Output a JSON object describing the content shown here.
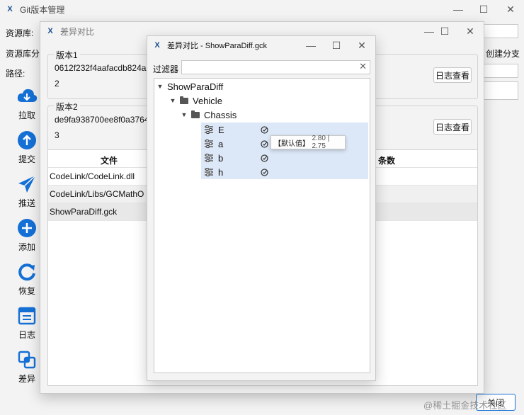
{
  "main_window": {
    "title": "Git版本管理",
    "label_repo": "资源库:",
    "label_branch": "资源库分",
    "label_path": "路径:",
    "create_branch": "创建分支",
    "close_button": "关闭",
    "toolbar": [
      {
        "label": "拉取",
        "icon": "cloud-download-icon"
      },
      {
        "label": "提交",
        "icon": "upload-icon"
      },
      {
        "label": "推送",
        "icon": "send-icon"
      },
      {
        "label": "添加",
        "icon": "add-icon"
      },
      {
        "label": "恢复",
        "icon": "restore-icon"
      },
      {
        "label": "日志",
        "icon": "log-icon"
      },
      {
        "label": "差异",
        "icon": "diff-icon"
      }
    ]
  },
  "diff_window": {
    "title": "差异对比",
    "version1": {
      "label": "版本1",
      "hash": "0612f232f4aafacdb824a",
      "number": "2",
      "log_button": "日志查看"
    },
    "version2": {
      "label": "版本2",
      "hash": "de9fa938700ee8f0a3764",
      "number": "3",
      "log_button": "日志查看"
    },
    "table": {
      "col_file": "文件",
      "col_count": "条数",
      "rows": [
        "CodeLink/CodeLink.dll",
        "CodeLink/Libs/GCMathO",
        "ShowParaDiff.gck"
      ]
    }
  },
  "para_window": {
    "title": "差异对比 - ShowParaDiff.gck",
    "filter_label": "过滤器",
    "filter_value": "",
    "tree": {
      "root": "ShowParaDiff",
      "level1": "Vehicle",
      "level2": "Chassis",
      "params": [
        "E",
        "a",
        "b",
        "h"
      ]
    },
    "tooltip": {
      "tag": "【默认值】",
      "values": "2.80 | 2.75"
    }
  },
  "watermark": "@稀土掘金技术社区",
  "colors": {
    "accent": "#1570d6",
    "selection": "#dce7f7"
  }
}
